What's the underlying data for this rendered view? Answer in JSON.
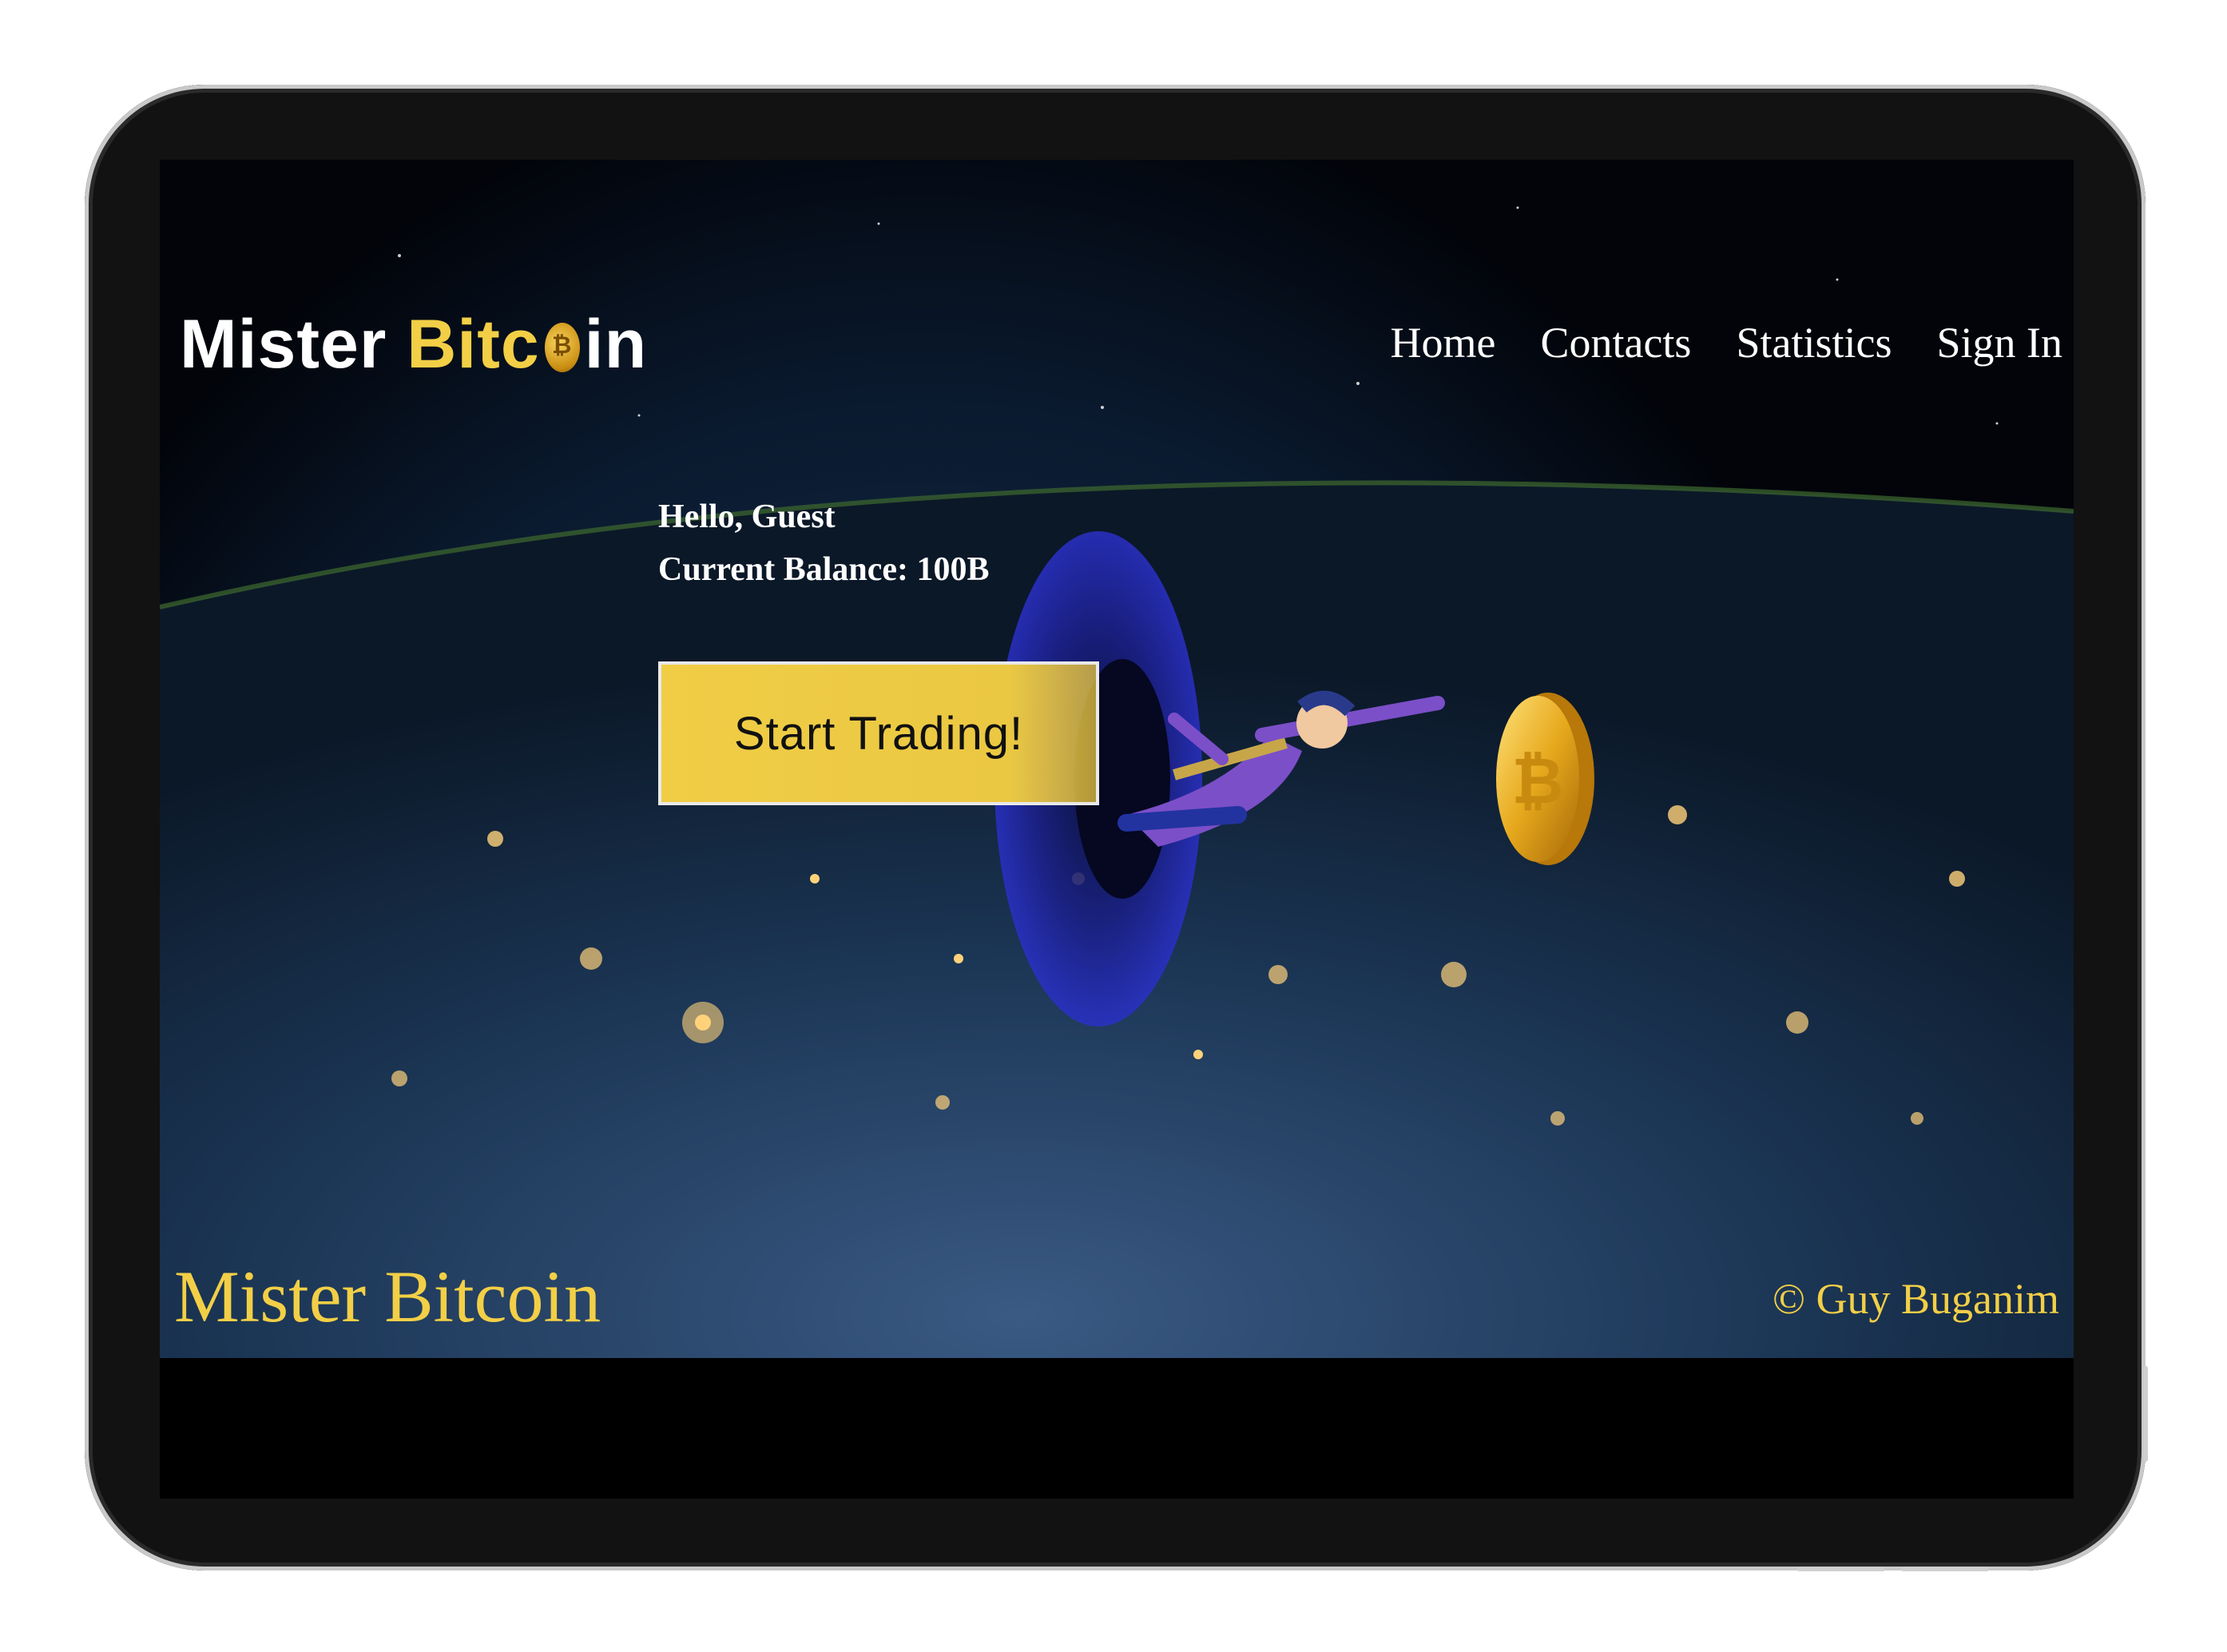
{
  "brand": {
    "logo_prefix": "Mister ",
    "logo_accent": "Bitc",
    "logo_suffix": "in"
  },
  "nav": {
    "items": [
      {
        "label": "Home"
      },
      {
        "label": "Contacts"
      },
      {
        "label": "Statistics"
      },
      {
        "label": "Sign In"
      }
    ]
  },
  "user": {
    "greeting": "Hello, Guest",
    "balance": "Current Balance: 100B"
  },
  "cta": {
    "label": "Start Trading!"
  },
  "footer": {
    "brand": "Mister Bitcoin",
    "copyright": "© Guy Buganim"
  },
  "colors": {
    "accent": "#f2cf46",
    "background": "#000000",
    "text": "#ffffff"
  },
  "icons": {
    "logo_coin": "bitcoin-coin-icon",
    "hero_coin": "bitcoin-coin-icon"
  }
}
